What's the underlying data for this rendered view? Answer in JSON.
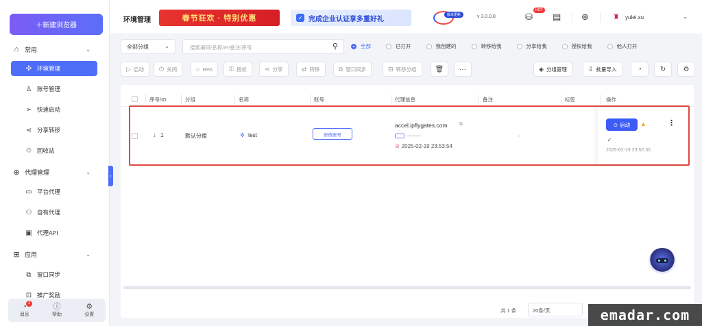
{
  "sidebar": {
    "new_button": "＋新建浏览器",
    "groups": [
      {
        "label": "常用",
        "icon": "home-icon"
      },
      {
        "label": "代理管理",
        "icon": "globe-icon"
      },
      {
        "label": "应用",
        "icon": "apps-icon"
      }
    ],
    "items": [
      {
        "label": "环境管理",
        "icon": "environment-icon"
      },
      {
        "label": "账号管理",
        "icon": "user-icon"
      },
      {
        "label": "快速启动",
        "icon": "send-icon"
      },
      {
        "label": "分享转移",
        "icon": "share-icon"
      },
      {
        "label": "回收站",
        "icon": "recycle-icon"
      },
      {
        "label": "平台代理",
        "icon": "monitor-icon"
      },
      {
        "label": "自有代理",
        "icon": "people-icon"
      },
      {
        "label": "代理API",
        "icon": "api-icon"
      },
      {
        "label": "窗口同步",
        "icon": "sync-icon"
      },
      {
        "label": "推广奖励",
        "icon": "gift-icon"
      }
    ],
    "footer": [
      {
        "label": "消息",
        "icon": "message-icon",
        "badge": "1"
      },
      {
        "label": "帮助",
        "icon": "help-icon"
      },
      {
        "label": "设置",
        "icon": "gear-icon"
      }
    ]
  },
  "header": {
    "title": "环境管理",
    "banner_promo": "春节狂欢 · 特别优惠",
    "banner_verify": "完成企业认证享多重好礼",
    "version_badge": "版本更新",
    "version": "v 3.0.0.8",
    "hot_badge": "HOT",
    "username": "yulei.xu"
  },
  "filters": {
    "group_select": "全部分组",
    "search_placeholder": "搜索编码/名称/IP/备注/序号",
    "radios": [
      "全部",
      "已打开",
      "我创建的",
      "转移给我",
      "分享给我",
      "授权给我",
      "他人打开"
    ],
    "selected_radio": "全部"
  },
  "toolbar": {
    "buttons": [
      "启动",
      "关闭",
      "RPA",
      "授权",
      "分享",
      "转移",
      "窗口同步",
      "转移分组"
    ],
    "right_buttons": [
      "分组管理",
      "批量导入"
    ]
  },
  "table": {
    "headers": [
      "序号/ID",
      "分组",
      "名称",
      "账号",
      "代理信息",
      "备注",
      "标签",
      "操作"
    ],
    "rows": [
      {
        "index": "1",
        "group": "默认分组",
        "name": "test",
        "account_button": "修改账号",
        "proxy_host": "accel.ipflygates.com",
        "proxy_time": "2025-02-19 23:53:54",
        "remark": "-",
        "start_button": "启动",
        "op_time": "2025-02-19 23:52:30"
      }
    ]
  },
  "footer": {
    "total": "共 1 条",
    "page_size": "20条/页"
  },
  "watermark": "emadar.com",
  "colors": {
    "accent": "#4f6ef7",
    "highlight_border": "#e0463f",
    "promo_red": "#d61f26"
  }
}
